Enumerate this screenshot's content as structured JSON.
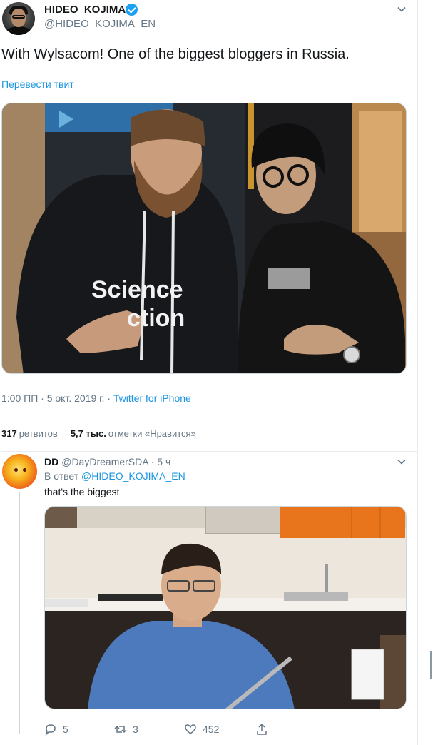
{
  "main_tweet": {
    "author_name": "HIDEO_KOJIMA",
    "author_handle": "@HIDEO_KOJIMA_EN",
    "text": "With Wylsacom! One of the biggest bloggers in Russia.",
    "translate_label": "Перевести твит",
    "time": "1:00 ПП",
    "date": "5 окт. 2019 г.",
    "separator": " · ",
    "source": "Twitter for iPhone",
    "retweets_count": "317",
    "retweets_label": "ретвитов",
    "likes_count": "5,7 тыс.",
    "likes_label": "отметки «Нравится»",
    "shirt_text_1": "Science",
    "shirt_text_2": "ction"
  },
  "reply_tweet": {
    "author_name": "DD",
    "author_handle": "@DayDreamerSDA",
    "age": "5 ч",
    "reply_prefix": "В ответ",
    "reply_mention": "@HIDEO_KOJIMA_EN",
    "text": "that's the biggest",
    "reply_count": "5",
    "retweet_count": "3",
    "like_count": "452"
  },
  "colors": {
    "link": "#1b95e0",
    "verified": "#1da1f2",
    "secondary_text": "#657786",
    "divider": "#e6ecf0"
  },
  "icons": [
    "verified-icon",
    "chevron-down-icon",
    "reply-icon",
    "retweet-icon",
    "like-icon",
    "share-icon"
  ]
}
